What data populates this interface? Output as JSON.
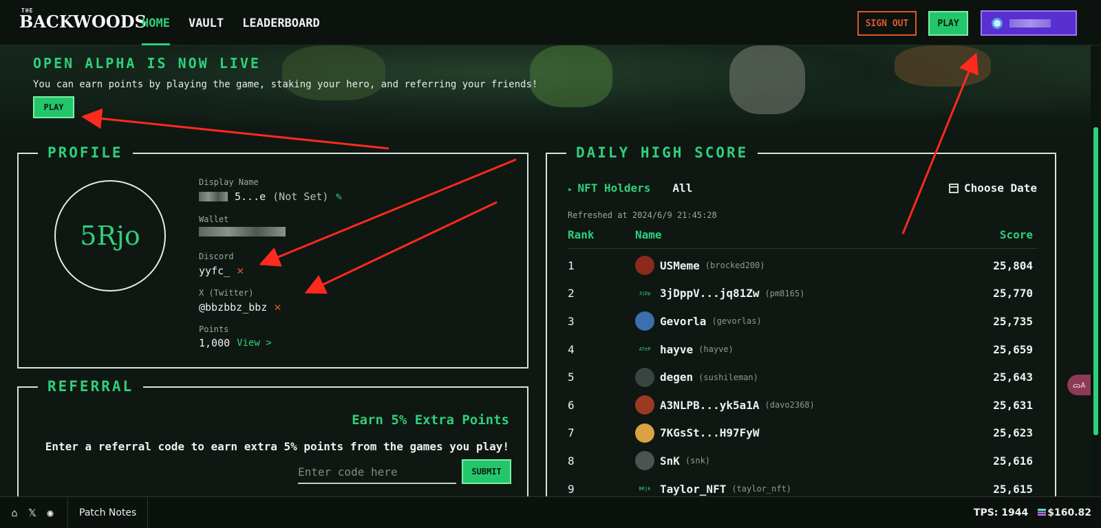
{
  "header": {
    "logo_small": "THE",
    "logo_main": "BACKWOODS",
    "nav": [
      {
        "label": "HOME",
        "active": true
      },
      {
        "label": "VAULT",
        "active": false
      },
      {
        "label": "LEADERBOARD",
        "active": false
      }
    ],
    "sign_out_label": "SIGN OUT",
    "play_label": "PLAY"
  },
  "banner": {
    "title": "OPEN ALPHA IS NOW LIVE",
    "text": "You can earn points by playing the game, staking your hero, and referring your friends!",
    "play_label": "PLAY"
  },
  "profile": {
    "title": "PROFILE",
    "avatar_text": "5Rjo",
    "display_name_label": "Display Name",
    "display_name_visible": "5...e",
    "not_set": "(Not Set)",
    "wallet_label": "Wallet",
    "discord_label": "Discord",
    "discord_value": "yyfc_",
    "twitter_label": "X (Twitter)",
    "twitter_value": "@bbzbbz_bbz",
    "points_label": "Points",
    "points_value": "1,000",
    "view_label": "View >"
  },
  "referral": {
    "title": "REFERRAL",
    "earn": "Earn 5% Extra Points",
    "desc": "Enter a referral code to earn extra 5% points from the games you play!",
    "input_placeholder": "Enter code here",
    "submit_label": "SUBMIT"
  },
  "daily": {
    "title": "DAILY HIGH SCORE",
    "filter_nft": "NFT Holders",
    "filter_all": "All",
    "choose_date": "Choose Date",
    "refreshed": "Refreshed at 2024/6/9 21:45:28",
    "col_rank": "Rank",
    "col_name": "Name",
    "col_score": "Score",
    "rows": [
      {
        "rank": "1",
        "name": "USMeme",
        "handle": "(brocked200)",
        "score": "25,804",
        "avatar_color": "#8b2a1e",
        "avatar_text": ""
      },
      {
        "rank": "2",
        "name": "3jDppV...jq81Zw",
        "handle": "(pm8165)",
        "score": "25,770",
        "avatar_color": "#0f1712",
        "avatar_text": "3jDp"
      },
      {
        "rank": "3",
        "name": "Gevorla",
        "handle": "(gevorlas)",
        "score": "25,735",
        "avatar_color": "#3b6fb0",
        "avatar_text": ""
      },
      {
        "rank": "4",
        "name": "hayve",
        "handle": "(hayve)",
        "score": "25,659",
        "avatar_color": "#0f1712",
        "avatar_text": "ATeP"
      },
      {
        "rank": "5",
        "name": "degen",
        "handle": "(sushileman)",
        "score": "25,643",
        "avatar_color": "#3a4440",
        "avatar_text": ""
      },
      {
        "rank": "6",
        "name": "A3NLPB...yk5a1A",
        "handle": "(davo2368)",
        "score": "25,631",
        "avatar_color": "#9a3a22",
        "avatar_text": ""
      },
      {
        "rank": "7",
        "name": "7KGsSt...H97FyW",
        "handle": "",
        "score": "25,623",
        "avatar_color": "#d9a441",
        "avatar_text": ""
      },
      {
        "rank": "8",
        "name": "SnK",
        "handle": "(snk)",
        "score": "25,616",
        "avatar_color": "#4a5450",
        "avatar_text": ""
      },
      {
        "rank": "9",
        "name": "Taylor_NFT",
        "handle": "(taylor_nft)",
        "score": "25,615",
        "avatar_color": "#0f1712",
        "avatar_text": "BRjk"
      }
    ]
  },
  "side": {
    "translate_label": "ᯅA"
  },
  "footer": {
    "home_icon": "⌂",
    "x_icon": "𝕏",
    "discord_icon": "◉",
    "patch_notes": "Patch Notes",
    "tps": "TPS: 1944",
    "price": "$160.82"
  },
  "colors": {
    "accent": "#2fd07a",
    "danger": "#e0582d",
    "wallet": "#5a2fd1",
    "annotation_arrow": "#ff2a1f"
  }
}
